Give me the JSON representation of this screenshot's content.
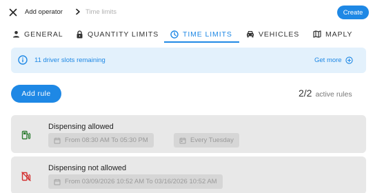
{
  "header": {
    "breadcrumb": [
      "Add operator",
      "Time limits"
    ],
    "create_label": "Create"
  },
  "tabs": [
    {
      "label": "GENERAL",
      "icon": "person-icon"
    },
    {
      "label": "QUANTITY LIMITS",
      "icon": "lock-icon"
    },
    {
      "label": "TIME LIMITS",
      "icon": "clock-icon",
      "active": true
    },
    {
      "label": "VEHICLES",
      "icon": "car-icon"
    },
    {
      "label": "MAPLY",
      "icon": "map-icon"
    }
  ],
  "banner": {
    "text": "11 driver slots remaining",
    "link": "Get more"
  },
  "add_rule_label": "Add rule",
  "rules_summary": {
    "count": "2/2",
    "label": "active rules"
  },
  "rules": [
    {
      "title": "Dispensing allowed",
      "status": "allowed",
      "chips": [
        "From 08:30 AM To 05:30 PM",
        "Every Tuesday"
      ]
    },
    {
      "title": "Dispensing not allowed",
      "status": "blocked",
      "chips": [
        "From 03/09/2026 10:52 AM To 03/16/2026 10:52 AM"
      ]
    }
  ],
  "colors": {
    "accent": "#1e88e5",
    "allowed": "#2e7d32",
    "blocked": "#d32f2f",
    "banner_bg": "#e3f1fc",
    "card_bg": "#e8e8e8"
  }
}
